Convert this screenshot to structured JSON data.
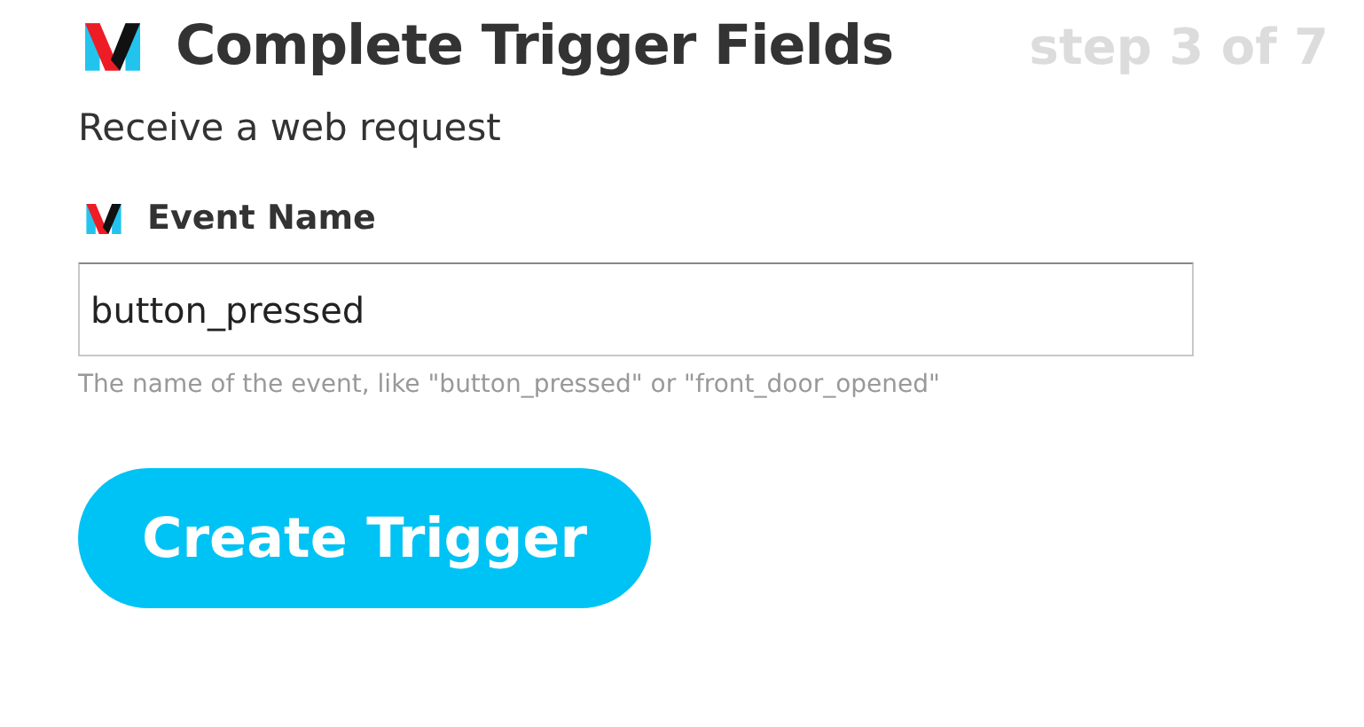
{
  "header": {
    "title": "Complete Trigger Fields",
    "step": "step 3 of 7"
  },
  "subtitle": "Receive a web request",
  "field": {
    "label": "Event Name",
    "value": "button_pressed",
    "hint": "The name of the event, like \"button_pressed\" or \"front_door_opened\""
  },
  "button": {
    "label": "Create Trigger"
  }
}
